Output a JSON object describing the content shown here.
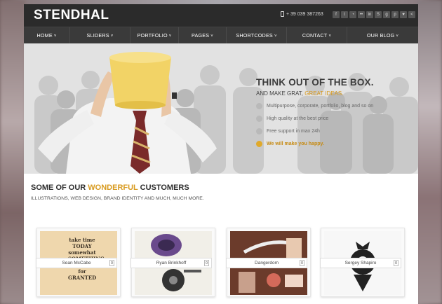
{
  "header": {
    "logo": "STENDHAL",
    "phone": "+ 39 039 387263",
    "social_icons": [
      "facebook-icon",
      "twitter-icon",
      "rss-icon",
      "flickr-icon",
      "linkedin-icon",
      "skype-icon",
      "google-plus-icon",
      "pinterest-icon",
      "dribbble-icon",
      "share-icon"
    ]
  },
  "nav": {
    "items": [
      {
        "label": "HOME"
      },
      {
        "label": "SLIDERS"
      },
      {
        "label": "PORTFOLIO"
      },
      {
        "label": "PAGES"
      },
      {
        "label": "SHORTCODES"
      },
      {
        "label": "CONTACT"
      },
      {
        "label": "OUR BLOG"
      }
    ]
  },
  "hero": {
    "title": "THINK OUT OF THE BOX.",
    "sub_prefix": "AND MAKE GRAT, ",
    "sub_highlight": "GREAT IDEAS.",
    "features": [
      "Multipurpose, corporate, portfolio, blog and so on",
      "High quality at the best price",
      "Free support in max 24h",
      "We will make you happy."
    ]
  },
  "customers": {
    "title_prefix": "SOME OF OUR ",
    "title_highlight": "WONDERFUL",
    "title_suffix": " CUSTOMERS",
    "subtitle": "ILLUSTRATIONS, WEB DESIGN, BRAND IDENTITY AND MUCH, MUCH MORE.",
    "cards": [
      {
        "name": "Sean McCabe",
        "art_text": "take time TODAY somewhat SOMETHING YOU ASK for GRANTED"
      },
      {
        "name": "Ryan Brinkhoff"
      },
      {
        "name": "Dangerdom"
      },
      {
        "name": "Sergey Shapiro"
      }
    ]
  },
  "colors": {
    "accent": "#d89a1e",
    "header_bg": "#2b2b2b",
    "nav_bg": "#3a3a3a"
  }
}
